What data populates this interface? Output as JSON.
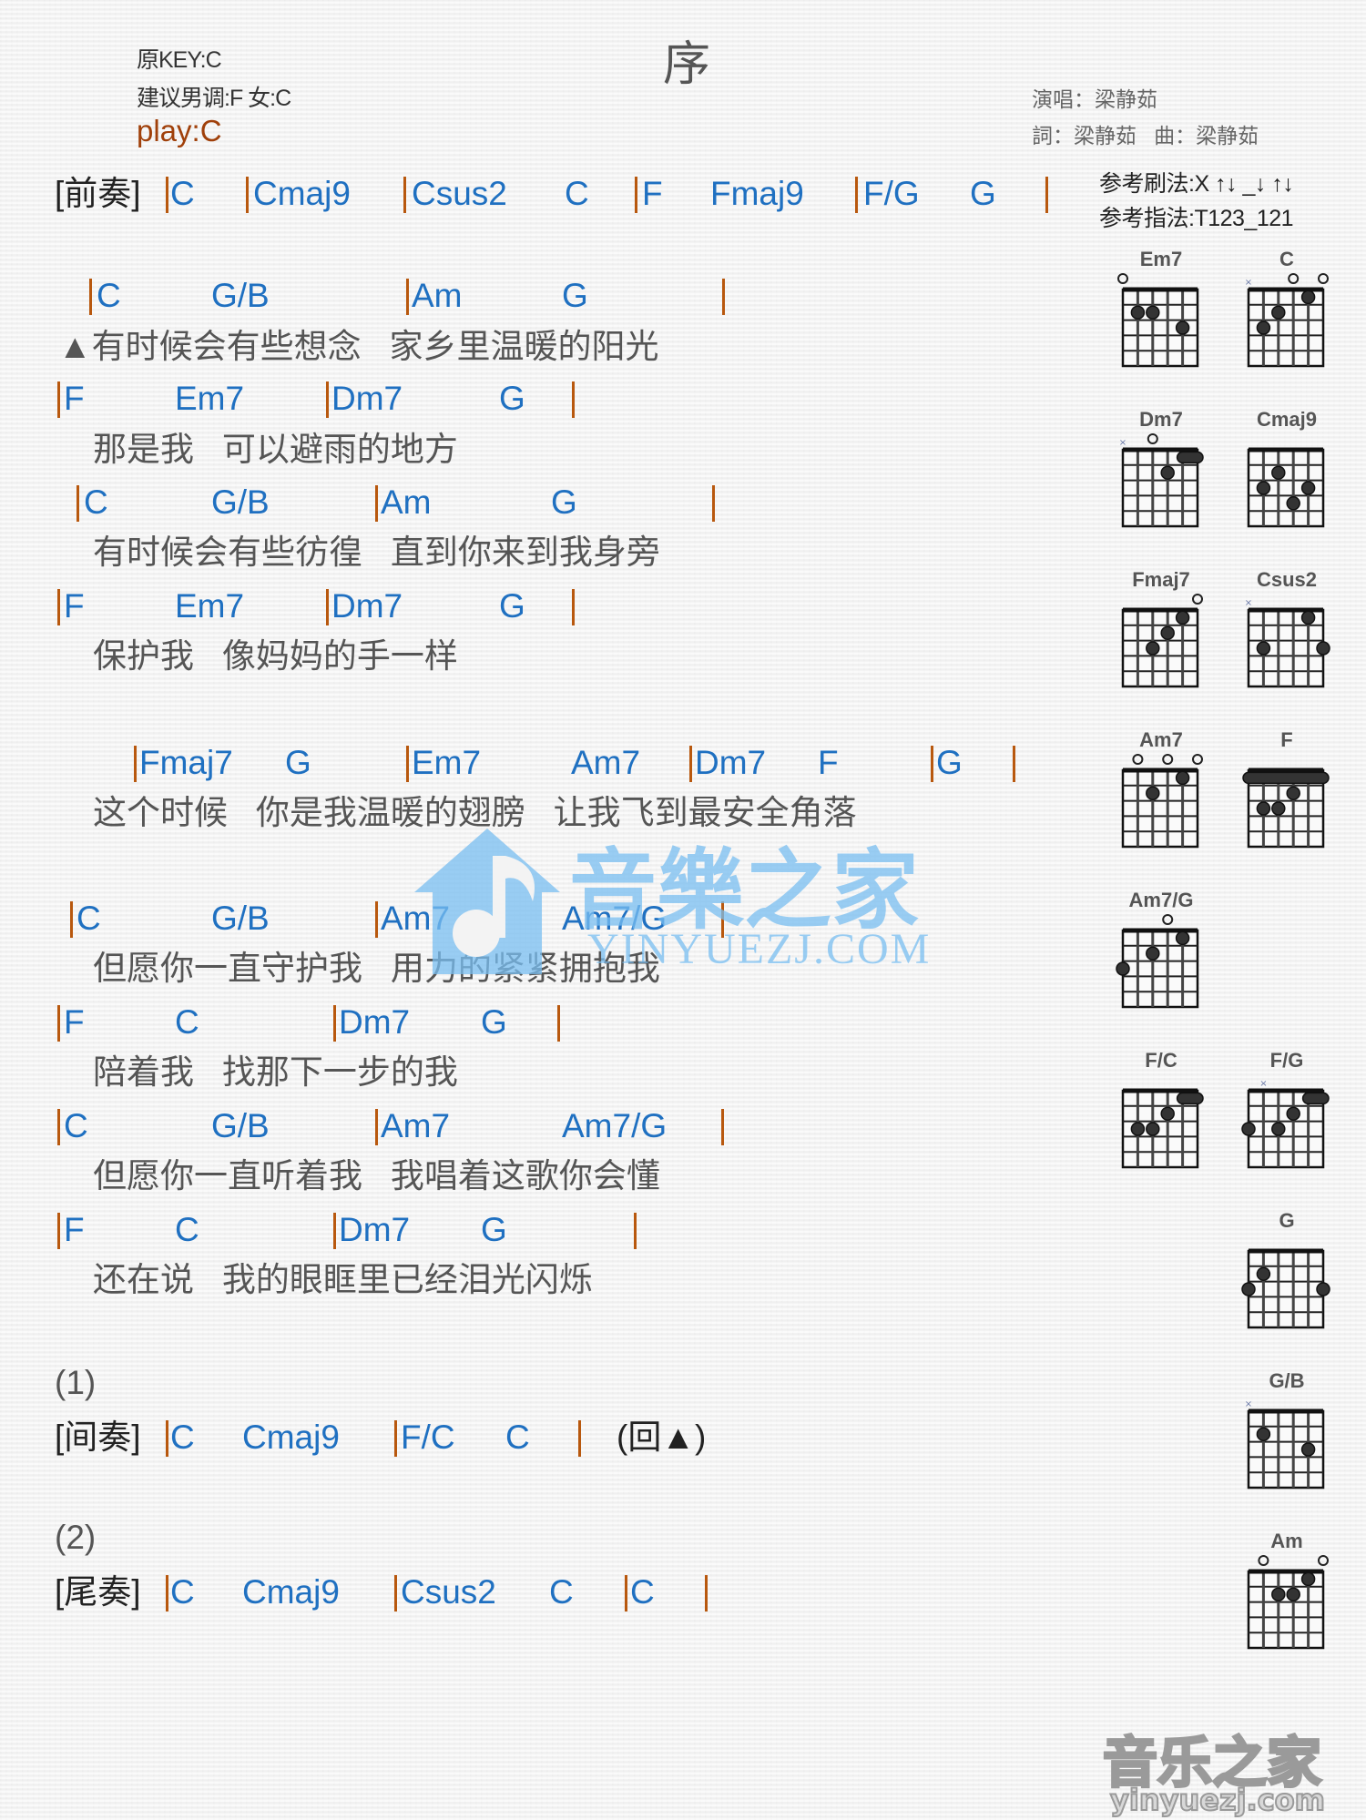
{
  "header": {
    "original_key": "原KEY:C",
    "suggested_key": "建议男调:F 女:C",
    "play_key": "play:C",
    "title": "序",
    "singer": "演唱：梁静茹",
    "lyricist_composer": "詞：梁静茹   曲：梁静茹",
    "strum_pattern": "参考刷法:X ↑↓ _↓ ↑↓",
    "pick_pattern": "参考指法:T123_121"
  },
  "sections": {
    "prelude": {
      "label": "[前奏]",
      "chords": [
        "C",
        "Cmaj9",
        "Csus2",
        "C",
        "F",
        "Fmaj9",
        "F/G",
        "G"
      ]
    },
    "interlude_marker": "(1)",
    "interlude": {
      "label": "[间奏]",
      "chords": [
        "C",
        "Cmaj9",
        "F/C",
        "C"
      ],
      "repeat": "(回▲)"
    },
    "outro_marker": "(2)",
    "outro": {
      "label": "[尾奏]",
      "chords": [
        "C",
        "Cmaj9",
        "Csus2",
        "C",
        "C"
      ]
    }
  },
  "verses": [
    {
      "chords": [
        "C",
        "G/B",
        "Am",
        "G"
      ],
      "lyric": "▲有时候会有些想念   家乡里温暖的阳光"
    },
    {
      "chords": [
        "F",
        "Em7",
        "Dm7",
        "G"
      ],
      "lyric": "那是我   可以避雨的地方"
    },
    {
      "chords": [
        "C",
        "G/B",
        "Am",
        "G"
      ],
      "lyric": "有时候会有些彷徨   直到你来到我身旁"
    },
    {
      "chords": [
        "F",
        "Em7",
        "Dm7",
        "G"
      ],
      "lyric": "保护我   像妈妈的手一样"
    },
    {
      "chords": [
        "Fmaj7",
        "G",
        "Em7",
        "Am7",
        "Dm7",
        "F",
        "G"
      ],
      "lyric": "这个时候   你是我温暖的翅膀   让我飞到最安全角落"
    },
    {
      "chords": [
        "C",
        "G/B",
        "Am7",
        "Am7/G"
      ],
      "lyric": "但愿你一直守护我   用力的紧紧拥抱我"
    },
    {
      "chords": [
        "F",
        "C",
        "Dm7",
        "G"
      ],
      "lyric": "陪着我   找那下一步的我"
    },
    {
      "chords": [
        "C",
        "G/B",
        "Am7",
        "Am7/G"
      ],
      "lyric": "但愿你一直听着我   我唱着这歌你会懂"
    },
    {
      "chords": [
        "F",
        "C",
        "Dm7",
        "G"
      ],
      "lyric": "还在说   我的眼眶里已经泪光闪烁"
    }
  ],
  "chord_diagrams": [
    {
      "name": "Em7",
      "open": [
        1
      ],
      "muted": [],
      "dots": [
        [
          2,
          2
        ],
        [
          3,
          2
        ],
        [
          5,
          3
        ]
      ],
      "barre": null
    },
    {
      "name": "C",
      "open": [
        4,
        6
      ],
      "muted": [
        1
      ],
      "dots": [
        [
          2,
          3
        ],
        [
          3,
          2
        ],
        [
          5,
          1
        ]
      ],
      "barre": null
    },
    {
      "name": "Dm7",
      "open": [
        3
      ],
      "muted": [
        1
      ],
      "dots": [
        [
          4,
          2
        ]
      ],
      "barre": [
        5,
        6,
        1
      ]
    },
    {
      "name": "Cmaj9",
      "open": [],
      "muted": [],
      "dots": [
        [
          2,
          3
        ],
        [
          3,
          2
        ],
        [
          4,
          4
        ],
        [
          5,
          3
        ]
      ],
      "barre": null
    },
    {
      "name": "Fmaj7",
      "open": [
        6
      ],
      "muted": [],
      "dots": [
        [
          3,
          3
        ],
        [
          4,
          2
        ],
        [
          5,
          1
        ]
      ],
      "barre": null
    },
    {
      "name": "Csus2",
      "open": [],
      "muted": [
        1
      ],
      "dots": [
        [
          2,
          3
        ],
        [
          5,
          1
        ],
        [
          6,
          3
        ]
      ],
      "barre": null
    },
    {
      "name": "Am7",
      "open": [
        2,
        4,
        6
      ],
      "muted": [],
      "dots": [
        [
          3,
          2
        ],
        [
          5,
          1
        ]
      ],
      "barre": null
    },
    {
      "name": "F",
      "open": [],
      "muted": [],
      "dots": [
        [
          2,
          3
        ],
        [
          3,
          3
        ],
        [
          4,
          2
        ]
      ],
      "barre": [
        1,
        6,
        1
      ]
    },
    {
      "name": "Am7/G",
      "open": [
        4
      ],
      "muted": [],
      "dots": [
        [
          1,
          3
        ],
        [
          3,
          2
        ],
        [
          5,
          1
        ]
      ],
      "barre": null
    },
    {
      "name": "F/C",
      "open": [],
      "muted": [],
      "dots": [
        [
          2,
          3
        ],
        [
          3,
          3
        ],
        [
          4,
          2
        ]
      ],
      "barre": [
        5,
        6,
        1
      ]
    },
    {
      "name": "F/G",
      "open": [],
      "muted": [
        2
      ],
      "dots": [
        [
          1,
          3
        ],
        [
          3,
          3
        ],
        [
          4,
          2
        ]
      ],
      "barre": [
        5,
        6,
        1
      ]
    },
    {
      "name": "G",
      "open": [],
      "muted": [],
      "dots": [
        [
          1,
          3
        ],
        [
          2,
          2
        ],
        [
          6,
          3
        ]
      ],
      "barre": null
    },
    {
      "name": "G/B",
      "open": [],
      "muted": [
        1
      ],
      "dots": [
        [
          2,
          2
        ],
        [
          5,
          3
        ]
      ],
      "barre": null
    },
    {
      "name": "Am",
      "open": [
        2,
        6
      ],
      "muted": [],
      "dots": [
        [
          3,
          2
        ],
        [
          4,
          2
        ],
        [
          5,
          1
        ]
      ],
      "barre": null
    }
  ],
  "watermark": {
    "center_text": "音樂之家",
    "center_url": "YINYUEZJ.COM",
    "corner_text": "音乐之家",
    "corner_url": "yinyuezj.com"
  }
}
